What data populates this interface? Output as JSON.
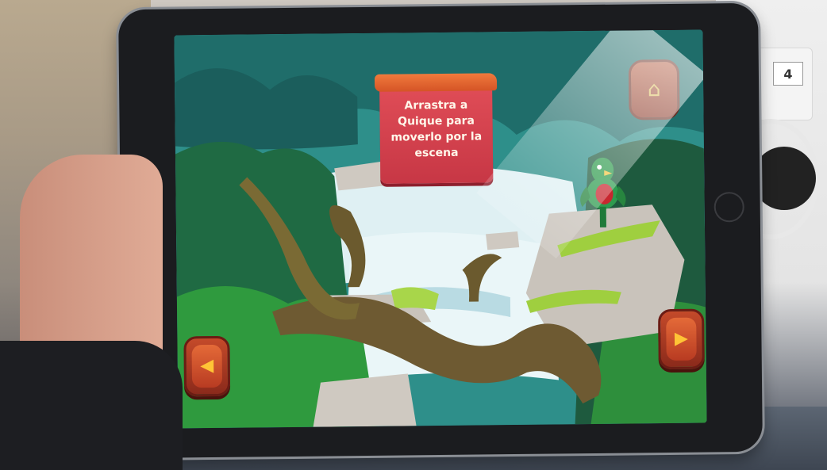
{
  "environment": {
    "outlet_label": "4"
  },
  "game": {
    "instruction": "Arrastra a Quique para moverlo por la escena",
    "buttons": {
      "home_icon": "home-icon",
      "prev_icon": "arrow-left-icon",
      "next_icon": "arrow-right-icon"
    },
    "character_name": "Quique",
    "colors": {
      "sign": "#d0404e",
      "sign_top": "#e86a30",
      "button": "#c44a2a",
      "arrow": "#ffc436",
      "jungle_dark": "#1f6a43",
      "water": "#e9f4f6"
    }
  }
}
